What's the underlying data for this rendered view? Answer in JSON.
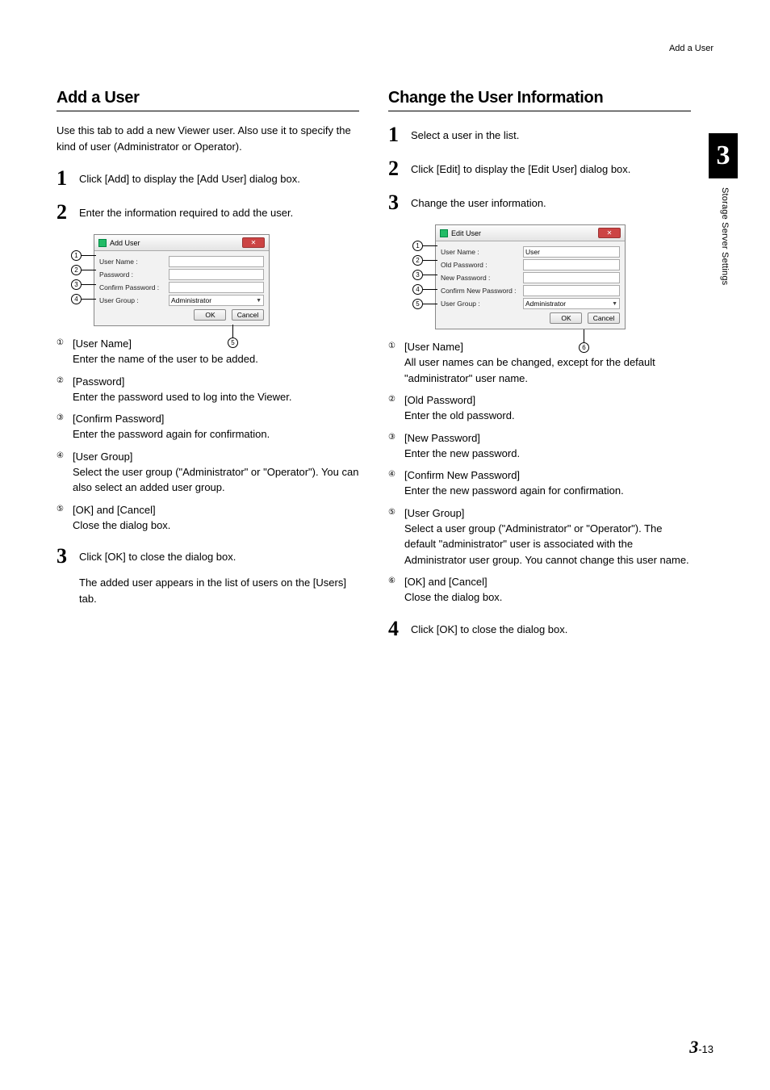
{
  "breadcrumb": "Add a User",
  "chapter_tab": "3",
  "side_label": "Storage Server Settings",
  "footer": {
    "chapter": "3",
    "sep": "-",
    "page": "13"
  },
  "left": {
    "heading": "Add a User",
    "intro": "Use this tab to add a new Viewer user. Also use it to specify the kind of user (Administrator or Operator).",
    "steps": [
      {
        "num": "1",
        "text": "Click [Add] to display the [Add User] dialog box."
      },
      {
        "num": "2",
        "text": "Enter the information required to add the user."
      },
      {
        "num": "3",
        "text": "Click [OK] to close the dialog box.",
        "after": "The added user appears in the list of users on the [Users] tab."
      }
    ],
    "dialog": {
      "title": "Add User",
      "rows": [
        {
          "label": "User Name :"
        },
        {
          "label": "Password :"
        },
        {
          "label": "Confirm Password :"
        },
        {
          "label": "User Group :",
          "select": "Administrator"
        }
      ],
      "ok": "OK",
      "cancel": "Cancel",
      "bottom_callout": "⑤"
    },
    "defs": [
      {
        "n": "①",
        "title": "[User Name]",
        "desc": "Enter the name of the user to be added."
      },
      {
        "n": "②",
        "title": "[Password]",
        "desc": "Enter the password used to log into the Viewer."
      },
      {
        "n": "③",
        "title": "[Confirm Password]",
        "desc": "Enter the password again for confirmation."
      },
      {
        "n": "④",
        "title": "[User Group]",
        "desc": "Select the user group (\"Administrator\" or \"Operator\"). You can also select an added user group."
      },
      {
        "n": "⑤",
        "title": "[OK] and [Cancel]",
        "desc": "Close the dialog box."
      }
    ]
  },
  "right": {
    "heading": "Change the User Information",
    "steps": [
      {
        "num": "1",
        "text": "Select a user in the list."
      },
      {
        "num": "2",
        "text": "Click [Edit] to display the [Edit User] dialog box."
      },
      {
        "num": "3",
        "text": "Change the user information."
      },
      {
        "num": "4",
        "text": "Click [OK] to close the dialog box."
      }
    ],
    "dialog": {
      "title": "Edit User",
      "rows": [
        {
          "label": "User Name :",
          "value": "User"
        },
        {
          "label": "Old Password :"
        },
        {
          "label": "New Password :"
        },
        {
          "label": "Confirm New Password :"
        },
        {
          "label": "User Group :",
          "select": "Administrator"
        }
      ],
      "ok": "OK",
      "cancel": "Cancel",
      "bottom_callout": "⑥"
    },
    "defs": [
      {
        "n": "①",
        "title": "[User Name]",
        "desc": "All user names can be changed, except for the default \"administrator\" user name."
      },
      {
        "n": "②",
        "title": "[Old Password]",
        "desc": "Enter the old password."
      },
      {
        "n": "③",
        "title": "[New Password]",
        "desc": "Enter the new password."
      },
      {
        "n": "④",
        "title": "[Confirm New Password]",
        "desc": "Enter the new password again for confirmation."
      },
      {
        "n": "⑤",
        "title": "[User Group]",
        "desc": "Select a user group (\"Administrator\" or \"Operator\"). The default \"administrator\" user is associated with the Administrator user group. You cannot change this user name."
      },
      {
        "n": "⑥",
        "title": "[OK] and [Cancel]",
        "desc": "Close the dialog box."
      }
    ]
  }
}
